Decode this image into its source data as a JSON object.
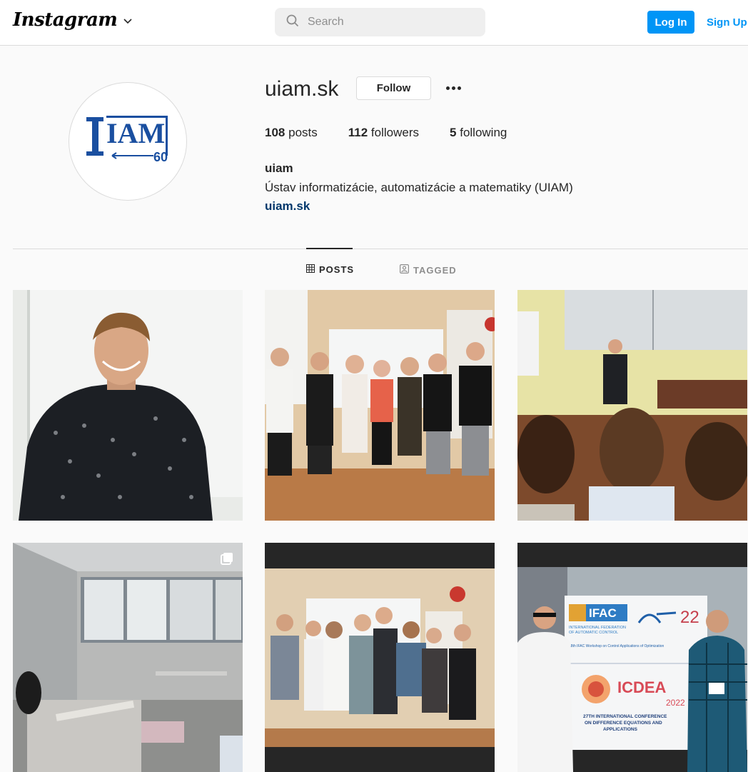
{
  "header": {
    "logo_text": "Instagram",
    "search_placeholder": "Search",
    "login_label": "Log In",
    "signup_label": "Sign Up"
  },
  "profile": {
    "username": "uiam.sk",
    "follow_label": "Follow",
    "stats": [
      {
        "count": "108",
        "label": "posts"
      },
      {
        "count": "112",
        "label": "followers"
      },
      {
        "count": "5",
        "label": "following"
      }
    ],
    "full_name": "uiam",
    "bio": "Ústav informatizácie, automatizácie a matematiky (UIAM)",
    "website": "uiam.sk",
    "avatar_logo": {
      "text": "IAM",
      "badge": "60",
      "color": "#1a4fa0"
    }
  },
  "tabs": [
    {
      "label": "POSTS",
      "icon": "grid-icon",
      "active": true
    },
    {
      "label": "TAGGED",
      "icon": "tag-icon",
      "active": false
    }
  ],
  "posts": [
    {
      "description": "portrait of smiling man",
      "icon": null
    },
    {
      "description": "group of seven students",
      "icon": null
    },
    {
      "description": "lecture hall presentation",
      "icon": null
    },
    {
      "description": "lab room under renovation",
      "icon": "carousel-icon"
    },
    {
      "description": "group photo of researchers",
      "icon": null
    },
    {
      "description": "conference poster photo",
      "icon": null
    }
  ],
  "poster": {
    "ifac_label": "IFAC",
    "ifac_sub1": "INTERNATIONAL FEDERATION",
    "ifac_sub2": "OF AUTOMATIC CONTROL",
    "cao_label": "22",
    "workshop_text": "18th IFAC Workshop on Control Applications of Optimization",
    "icdea_label": "ICDEA",
    "icdea_year": "2022",
    "conf_line1": "27TH INTERNATIONAL CONFERENCE",
    "conf_line2": "ON DIFFERENCE EQUATIONS AND",
    "conf_line3": "APPLICATIONS"
  },
  "colors": {
    "accent": "#0095f6",
    "link": "#00376b",
    "border": "#dbdbdb",
    "background": "#fafafa"
  }
}
